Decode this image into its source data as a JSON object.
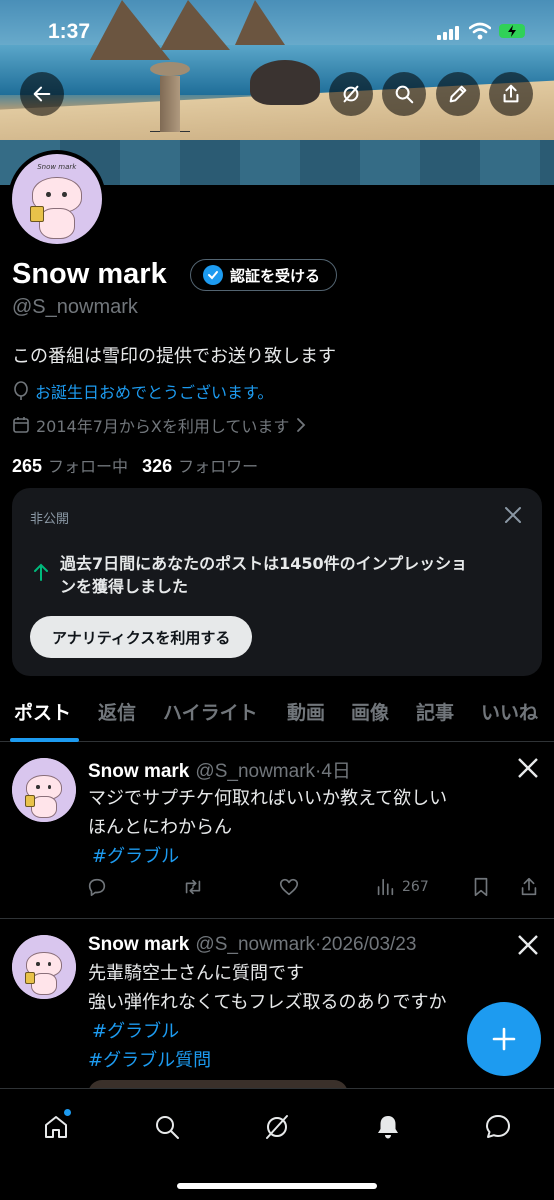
{
  "status_bar": {
    "time": "1:37"
  },
  "profile": {
    "display_name": "Snow mark",
    "verify_label": "認証を受ける",
    "handle": "@S_nowmark",
    "bio": "この番組は雪印の提供でお送り致します",
    "birthday": "お誕生日おめでとうございます。",
    "joined": "2014年7月からXを利用しています",
    "following_count": "265",
    "following_label": "フォロー中",
    "followers_count": "326",
    "followers_label": "フォロワー",
    "avatar_caption": "Snow mark"
  },
  "analytics_card": {
    "private_label": "非公開",
    "message_line1": "過去7日間にあなたのポストは1450件のインプレッショ",
    "message_line2": "ンを獲得しました",
    "button_label": "アナリティクスを利用する"
  },
  "tabs": [
    {
      "label": "ポスト"
    },
    {
      "label": "返信"
    },
    {
      "label": "ハイライト"
    },
    {
      "label": "動画"
    },
    {
      "label": "画像"
    },
    {
      "label": "記事"
    },
    {
      "label": "いいね"
    }
  ],
  "posts": [
    {
      "name": "Snow mark",
      "meta": "@S_nowmark·4日",
      "lines": [
        "マジでサプチケ何取ればいいか教えて欲しい",
        "ほんとにわからん"
      ],
      "tags": [
        "#グラブル"
      ],
      "views": "267"
    },
    {
      "name": "Snow mark",
      "meta": "@S_nowmark·2026/03/23",
      "lines": [
        "先輩騎空士さんに質問です",
        "強い弾作れなくてもフレズ取るのありですか"
      ],
      "tags": [
        "#グラブル",
        "#グラブル質問"
      ]
    }
  ],
  "colors": {
    "accent": "#1d9bf0",
    "background": "#000000",
    "card": "#16181c",
    "muted": "#71767b"
  },
  "icons": [
    "back-arrow-icon",
    "grok-icon",
    "search-icon",
    "edit-icon",
    "share-icon",
    "verified-badge-icon",
    "balloon-icon",
    "calendar-icon",
    "chevron-right-icon",
    "close-icon",
    "trending-up-icon",
    "x-logo-icon",
    "reply-icon",
    "repost-icon",
    "like-icon",
    "views-icon",
    "bookmark-icon",
    "plus-icon",
    "home-icon",
    "notifications-icon",
    "messages-icon"
  ]
}
